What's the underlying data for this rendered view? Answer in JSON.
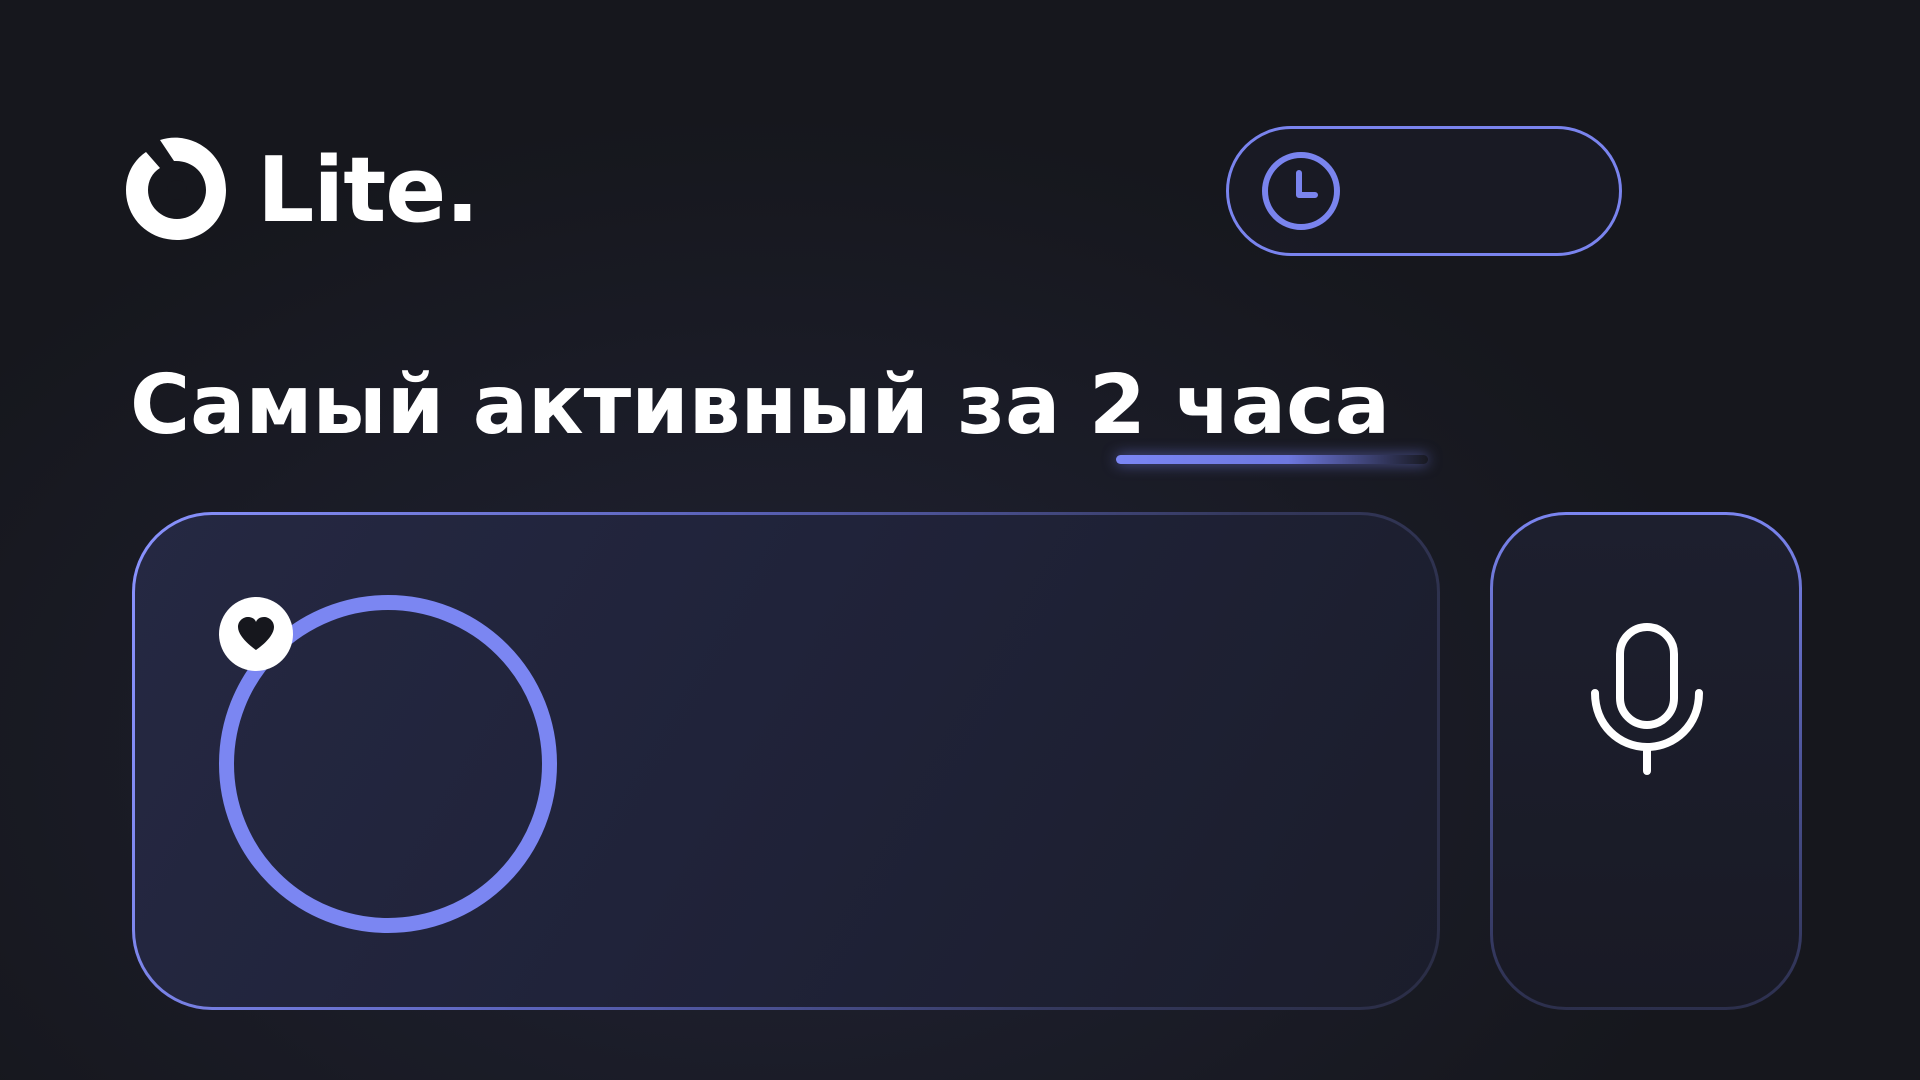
{
  "brand": {
    "name": "Lite.",
    "logo_icon": "lite-logo-mark"
  },
  "timer": {
    "icon": "clock-icon",
    "value": ""
  },
  "headline": {
    "text": "Самый активный за 2 часа",
    "accent_color": "#7b86f5"
  },
  "card": {
    "avatar_icon": "avatar-ring",
    "badge_icon": "heart-icon",
    "name": ""
  },
  "voice": {
    "icon": "microphone-icon"
  },
  "colors": {
    "background": "#16171d",
    "accent": "#7b86f2",
    "text": "#ffffff"
  }
}
